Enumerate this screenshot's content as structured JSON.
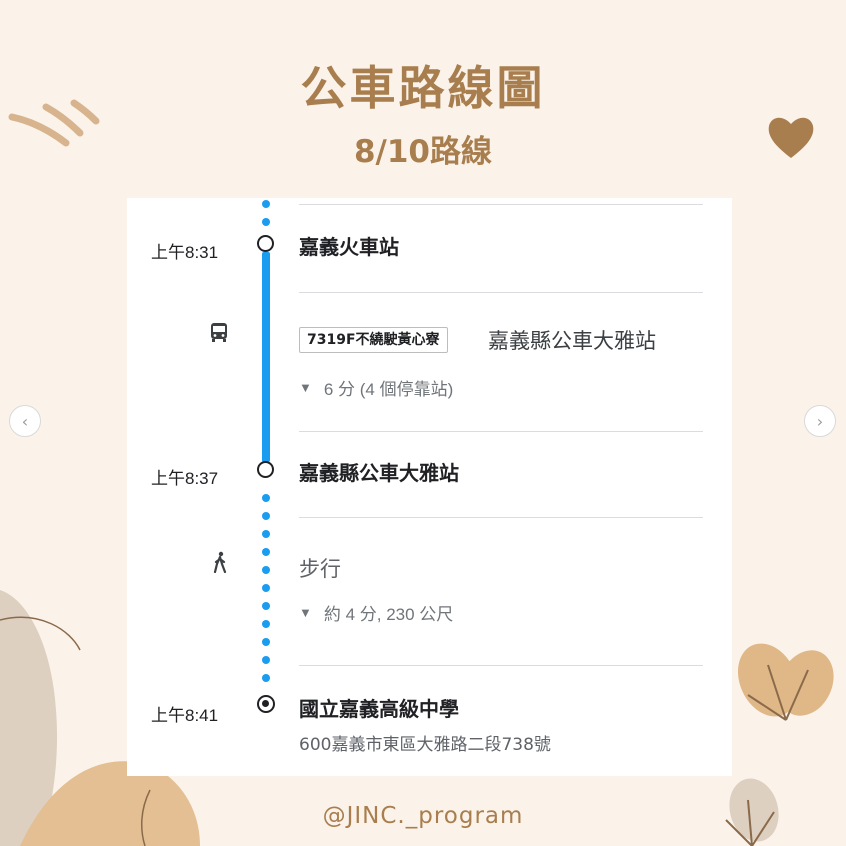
{
  "header": {
    "title": "公車路線圖",
    "subtitle": "8/10路線"
  },
  "route": {
    "origin": {
      "time": "上午8:31",
      "name": "嘉義火車站"
    },
    "bus_leg": {
      "icon": "bus-icon",
      "route_name": "7319F不繞駛黃心寮",
      "headsign": "嘉義縣公車大雅站",
      "details": "6 分 (4 個停靠站)"
    },
    "transfer": {
      "time": "上午8:37",
      "name": "嘉義縣公車大雅站"
    },
    "walk_leg": {
      "icon": "walking-icon",
      "label": "步行",
      "details": "約 4 分, 230 公尺"
    },
    "destination": {
      "time": "上午8:41",
      "name": "國立嘉義高級中學",
      "address": "600嘉義市東區大雅路二段738號"
    }
  },
  "colors": {
    "background": "#fbf3ea",
    "accent": "#a87e4e",
    "transit_line": "#1a9cf0"
  },
  "footer": {
    "watermark": "@JINC._program"
  }
}
